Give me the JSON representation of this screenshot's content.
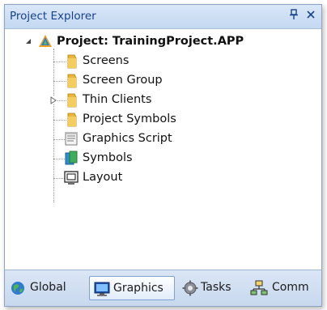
{
  "panel": {
    "title": "Project Explorer",
    "pin_glyph": "ѱ",
    "close_glyph": "✕"
  },
  "tree": {
    "root": {
      "label": "Project: TrainingProject.APP",
      "icon": "project-icon",
      "expanded": true
    },
    "items": [
      {
        "label": "Screens",
        "icon": "folder-icon",
        "expandable": false
      },
      {
        "label": "Screen Group",
        "icon": "folder-icon",
        "expandable": false
      },
      {
        "label": "Thin Clients",
        "icon": "folder-icon",
        "expandable": true
      },
      {
        "label": "Project Symbols",
        "icon": "folder-icon",
        "expandable": false
      },
      {
        "label": "Graphics Script",
        "icon": "script-icon",
        "expandable": false
      },
      {
        "label": "Symbols",
        "icon": "symbols-icon",
        "expandable": false
      },
      {
        "label": "Layout",
        "icon": "layout-icon",
        "expandable": false
      }
    ]
  },
  "tabs": [
    {
      "label": "Global",
      "icon": "globe-icon",
      "active": false
    },
    {
      "label": "Graphics",
      "icon": "monitor-icon",
      "active": true
    },
    {
      "label": "Tasks",
      "icon": "gear-icon",
      "active": false
    },
    {
      "label": "Comm",
      "icon": "network-icon",
      "active": false
    }
  ],
  "colors": {
    "title_text": "#15428b",
    "titlebar_bg": "#c4d8f1",
    "tab_strip_bg": "#c7d8ee",
    "folder": "#e8b43a"
  }
}
